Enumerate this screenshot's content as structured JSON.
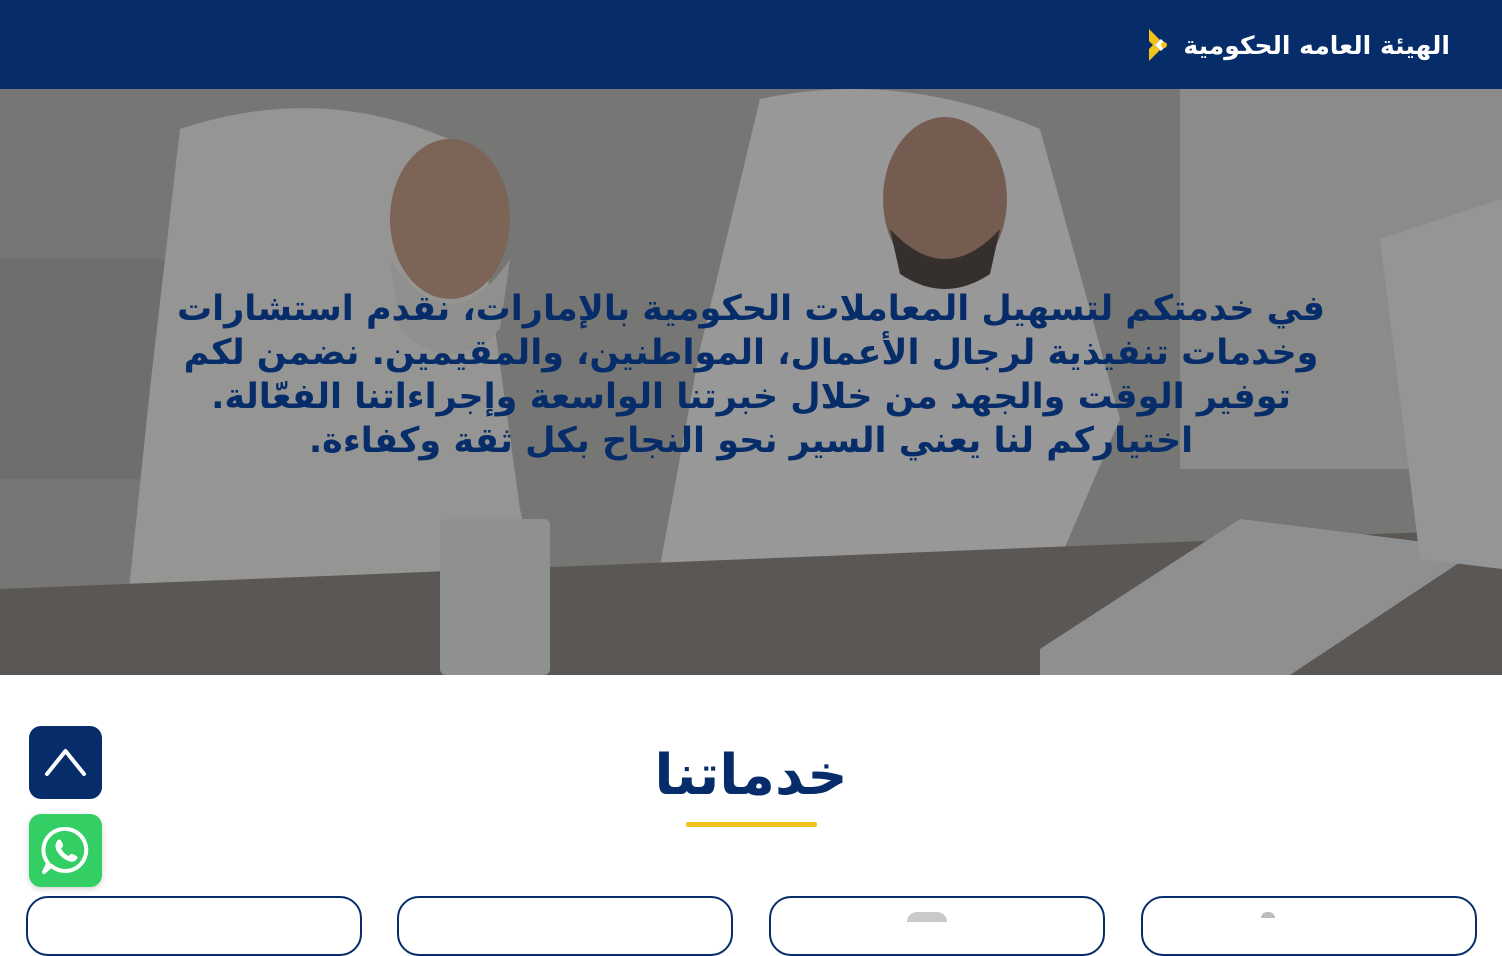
{
  "header": {
    "brand_name": "الهيئة العامه الحكومية",
    "logo_icon": "chevron-logo-icon",
    "background_color": "#062d69",
    "logo_color": "#f0c419"
  },
  "hero": {
    "text": "في خدمتكم لتسهيل المعاملات الحكومية بالإمارات، نقدم استشارات وخدمات تنفيذية لرجال الأعمال، المواطنين، والمقيمين. نضمن لكم توفير الوقت والجهد من خلال خبرتنا الواسعة وإجراءاتنا الفعّالة. اختياركم لنا يعني السير نحو النجاح بكل ثقة وكفاءة.",
    "text_color": "#062d69"
  },
  "services": {
    "title": "خدماتنا",
    "underline_color": "#f0c419",
    "card_count": 4
  },
  "floating": {
    "scroll_top_icon": "chevron-up-icon",
    "whatsapp_icon": "whatsapp-icon",
    "whatsapp_color": "#33cf64"
  }
}
